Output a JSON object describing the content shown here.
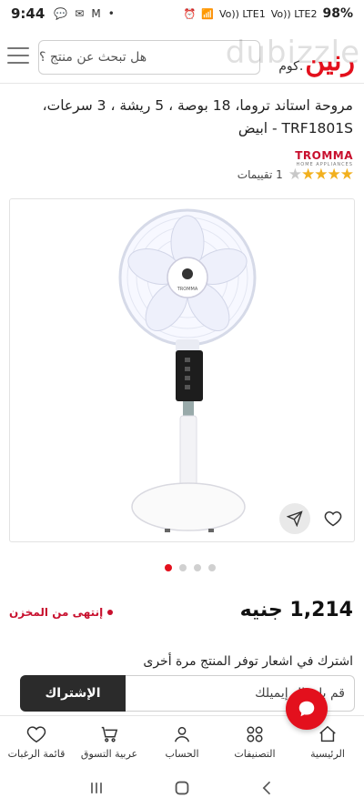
{
  "status_bar": {
    "time": "9:44",
    "battery": "98%",
    "signal_labels": [
      "Vo)) LTE1",
      "Vo)) LTE2"
    ]
  },
  "header": {
    "logo": "رنين",
    "logo_suffix": ".كوم",
    "watermark": "dubizzle",
    "search_placeholder": "هل تبحث عن منتج ؟"
  },
  "product": {
    "title": "مروحة استاند تروما، 18 بوصة ، 5 ريشة ، 3 سرعات، TRF1801S - ابيض",
    "brand": "TROMMA",
    "brand_tagline": "HOME APPLIANCES",
    "stars_filled": 4,
    "stars_total": 5,
    "ratings_label": "1 تقييمات",
    "image_slide_count": 4,
    "active_slide": 1,
    "price": "1,214 جنيه",
    "stock_status": "إنتهى من المخزن",
    "stock_color": "#c8102e"
  },
  "notify": {
    "label": "اشترك في اشعار توفر المنتج مرة أخرى",
    "email_placeholder": "قم بإدخال إيميلك",
    "subscribe_label": "الإشتراك"
  },
  "bottom_nav": [
    {
      "label": "الرئيسية",
      "icon": "home-icon"
    },
    {
      "label": "التصنيفات",
      "icon": "categories-icon"
    },
    {
      "label": "الحساب",
      "icon": "user-icon"
    },
    {
      "label": "عربية التسوق",
      "icon": "cart-icon"
    },
    {
      "label": "قائمة الرغبات",
      "icon": "heart-icon"
    }
  ],
  "colors": {
    "brand_red": "#e3101d",
    "dark_button": "#2b2b2b"
  }
}
